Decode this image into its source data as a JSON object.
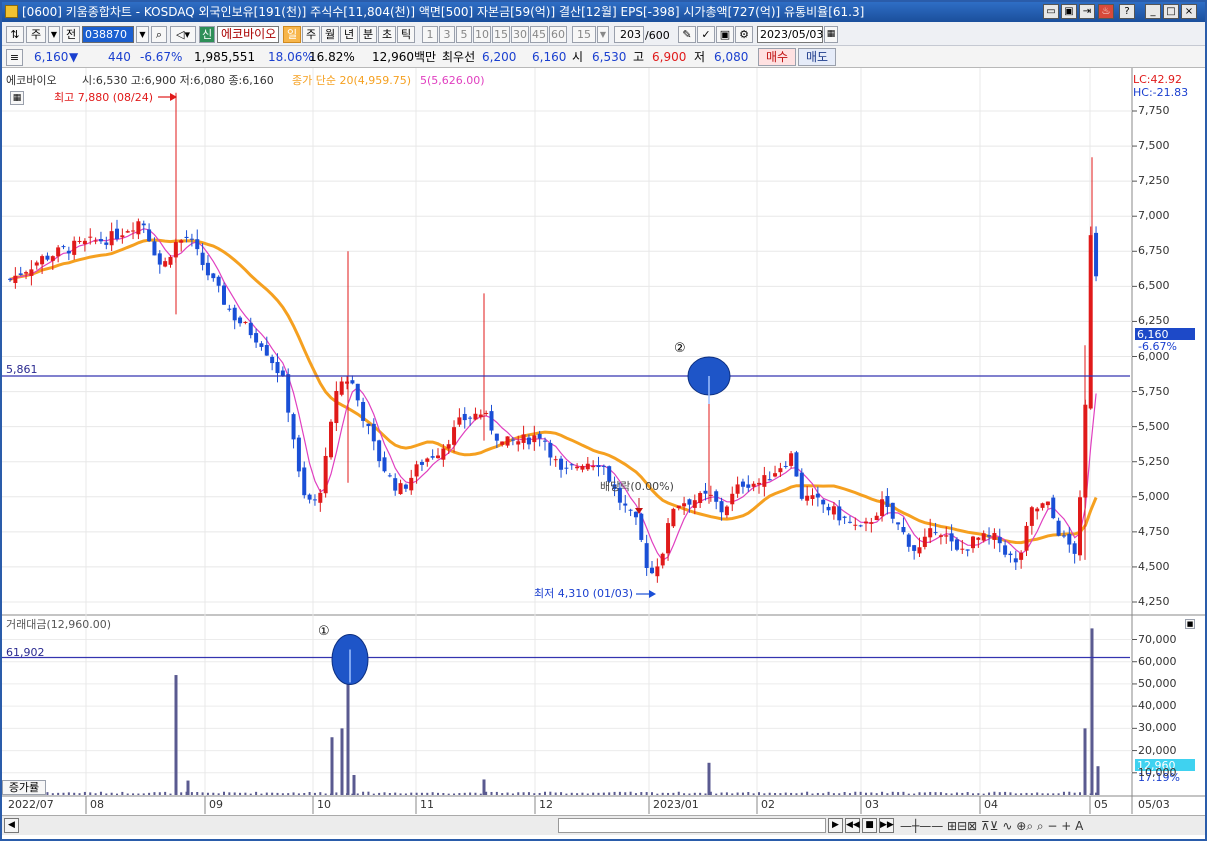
{
  "title_bar": {
    "text": "[0600] 키움종합차트 - KOSDAQ 외국인보유[191(천)] 주식수[11,804(천)] 액면[500] 자본금[59(억)] 결산[12월] EPS[-398] 시가총액[727(억)] 유통비율[61.3]",
    "win_buttons": [
      "?",
      "_",
      "□",
      "×"
    ]
  },
  "toolbar": {
    "type_label": "주",
    "prev_label": "전",
    "code": "038870",
    "new_badge": "신",
    "stock_name": "에코바이오",
    "periods": [
      "일",
      "주",
      "월",
      "년",
      "분",
      "초",
      "틱"
    ],
    "selected_period": "일",
    "intervals": [
      "1",
      "3",
      "5",
      "10",
      "15",
      "30",
      "45",
      "60"
    ],
    "interval_value": "15",
    "count": "203",
    "count_max": "/600",
    "date": "2023/05/03"
  },
  "quote": {
    "price": "6,160",
    "arrow": "▼",
    "change": "440",
    "change_pct": "-6.67%",
    "volume": "1,985,551",
    "pct1": "18.06%",
    "pct2": "16.82%",
    "amount": "12,960백만",
    "best_bid_label": "최우선",
    "best_bid1": "6,200",
    "best_bid2": "6,160",
    "open_label": "시",
    "open": "6,530",
    "high_label": "고",
    "high": "6,900",
    "low_label": "저",
    "low": "6,080",
    "buy_label": "매수",
    "sell_label": "매도"
  },
  "price_pane": {
    "legend_name": "에코바이오",
    "legend_ohlc": "시:6,530 고:6,900 저:6,080 종:6,160",
    "ma_legend": "종가 단순 20(4,959.75)",
    "ma5_legend": "5(5,626.00)",
    "lc": "LC:42.92",
    "hc": "HC:-21.83",
    "high_marker": "최고 7,880 (08/24)",
    "low_marker": "최저 4,310 (01/03)",
    "ex_div_label": "배당락(0.00%)",
    "hline_value": "5,861",
    "callout_2": "②",
    "last_price_tag": "6,160",
    "last_pct_tag": "-6.67%",
    "y_labels": [
      "7,750",
      "7,500",
      "7,250",
      "7,000",
      "6,750",
      "6,500",
      "6,250",
      "6,000",
      "5,750",
      "5,500",
      "5,250",
      "5,000",
      "4,750",
      "4,500",
      "4,250"
    ]
  },
  "volume_pane": {
    "legend": "거래대금(12,960.00)",
    "hline_value": "61,902",
    "callout_1": "①",
    "last_value_tag": "12,960",
    "last_pct_tag": "17.19%",
    "y_labels": [
      "70,000",
      "60,000",
      "50,000",
      "40,000",
      "30,000",
      "20,000",
      "10,000"
    ],
    "bottom_tab": "증가률"
  },
  "x_axis": [
    "2022/07",
    "08",
    "09",
    "10",
    "11",
    "12",
    "2023/01",
    "02",
    "03",
    "04",
    "05",
    "05/03"
  ],
  "colors": {
    "up": "#e01a1a",
    "down": "#1a4fd6",
    "ma20": "#f5a020",
    "ma5": "#e040c0",
    "hline": "#3434b0",
    "callout": "#1e55c8",
    "volume": "#5a5a90"
  },
  "chart_data": {
    "type": "candlestick",
    "y_range": [
      4250,
      7880
    ],
    "marked_high": {
      "date": "08/24",
      "value": 7880
    },
    "marked_low": {
      "date": "01/03",
      "value": 4310
    },
    "horizontal_line": 5861,
    "last": {
      "open": 6530,
      "high": 6900,
      "low": 6080,
      "close": 6160
    },
    "ma20_last": 4959.75,
    "ma5_last": 5626.0,
    "volume_y_range": [
      0,
      75000
    ],
    "volume_horizontal_line": 61902,
    "volume_last": 12960
  }
}
